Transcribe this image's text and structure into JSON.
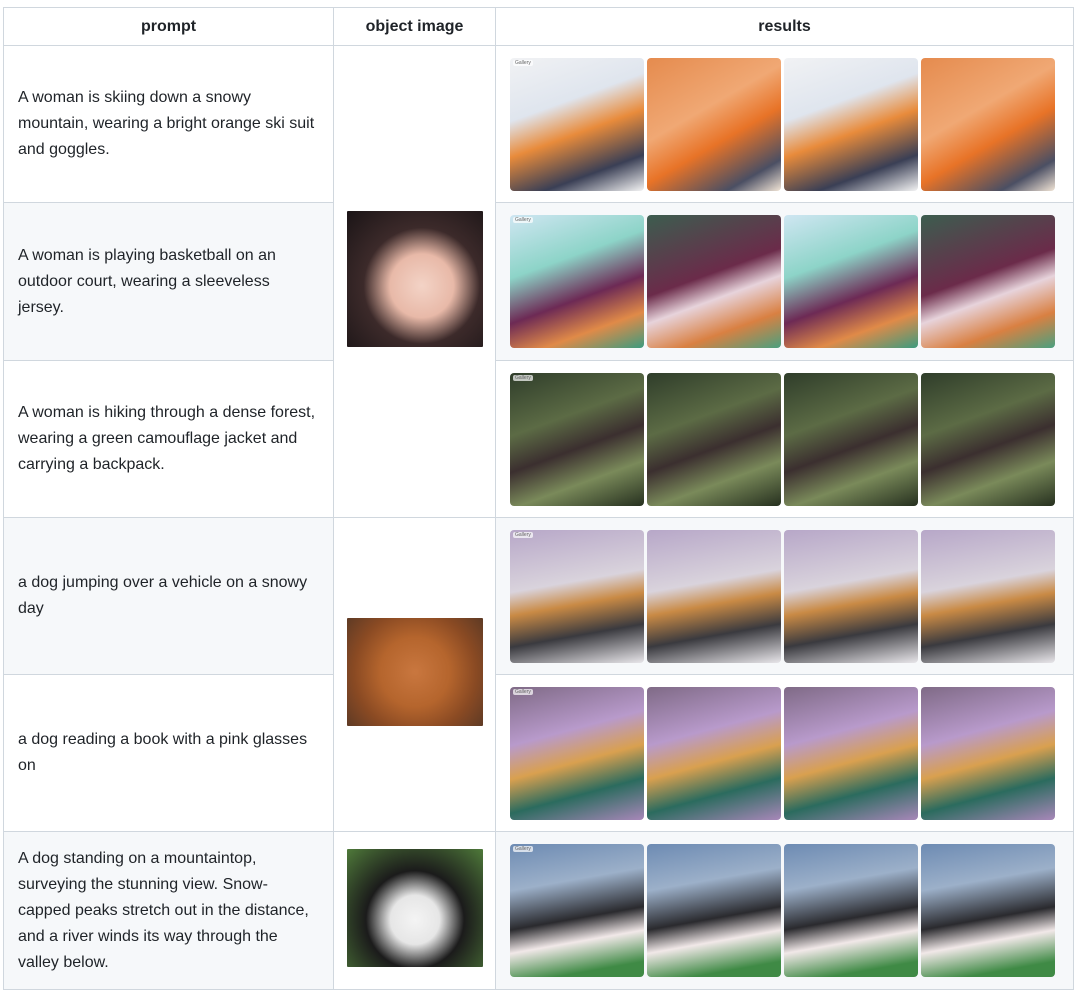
{
  "headers": {
    "prompt": "prompt",
    "object_image": "object image",
    "results": "results"
  },
  "gallery_tag": "Gallery",
  "rows": [
    {
      "prompt": "A woman is skiing down a snowy mountain, wearing a bright orange ski suit and goggles."
    },
    {
      "prompt": "A woman is playing basketball on an outdoor court, wearing a sleeveless jersey."
    },
    {
      "prompt": "A woman is hiking through a dense forest, wearing a green camouflage jacket and carrying a backpack."
    },
    {
      "prompt": "a dog jumping over a vehicle on a snowy day"
    },
    {
      "prompt": "a dog reading a book with a pink glasses on"
    },
    {
      "prompt": "A dog standing on a mountaintop, surveying the stunning view. Snow-capped peaks stretch out in the distance, and a river winds its way through the valley below."
    }
  ]
}
